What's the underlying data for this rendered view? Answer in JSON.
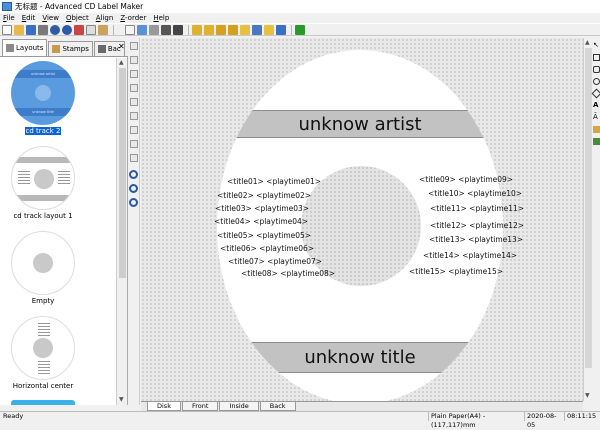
{
  "window": {
    "title_icon": "app-icon",
    "title": "无标题 - Advanced CD Label Maker"
  },
  "menu": [
    {
      "mnemonic": "F",
      "rest": "ile"
    },
    {
      "mnemonic": "E",
      "rest": "dit"
    },
    {
      "mnemonic": "V",
      "rest": "iew"
    },
    {
      "mnemonic": "O",
      "rest": "bject"
    },
    {
      "mnemonic": "A",
      "rest": "lign"
    },
    {
      "mnemonic": "Z",
      "rest": "-order"
    },
    {
      "mnemonic": "H",
      "rest": "elp"
    }
  ],
  "toolbar": {
    "close_glyph": "✕"
  },
  "left_tabs": [
    {
      "label": "Layouts",
      "active": true
    },
    {
      "label": "Stamps",
      "active": false
    },
    {
      "label": "Bac",
      "active": false
    }
  ],
  "layouts": [
    {
      "label": "cd track 2",
      "selected": true,
      "mini_artist": "unknow artist",
      "mini_title": "unknow title"
    },
    {
      "label": "cd track layout 1",
      "selected": false
    },
    {
      "label": "Empty",
      "selected": false
    },
    {
      "label": "Horizontal center",
      "selected": false
    }
  ],
  "disc": {
    "artist": "unknow artist",
    "title": "unknow title",
    "left_tracks": [
      "<title01>  <playtime01>",
      "<title02>  <playtime02>",
      "<title03>  <playtime03>",
      "<title04>  <playtime04>",
      "<title05>  <playtime05>",
      "<title06>  <playtime06>",
      "<title07>  <playtime07>",
      "<title08>  <playtime08>"
    ],
    "right_tracks": [
      "<title09>  <playtime09>",
      "<title10>  <playtime10>",
      "<title11>  <playtime11>",
      "<title12>  <playtime12>",
      "<title13>  <playtime13>",
      "<title14>  <playtime14>",
      "<title15>  <playtime15>"
    ]
  },
  "bottom_tabs": [
    {
      "label": "Disk",
      "active": true
    },
    {
      "label": "Front",
      "active": false
    },
    {
      "label": "Inside",
      "active": false
    },
    {
      "label": "Back",
      "active": false
    }
  ],
  "status": {
    "ready": "Ready",
    "paper": "Plain Paper(A4) - (117,117)mm",
    "date": "2020-08-05",
    "time": "08:11:15"
  },
  "colors": {
    "selection": "#0a64d8",
    "band": "#c2c2c2",
    "thumb_selected": "#5a9be0"
  }
}
